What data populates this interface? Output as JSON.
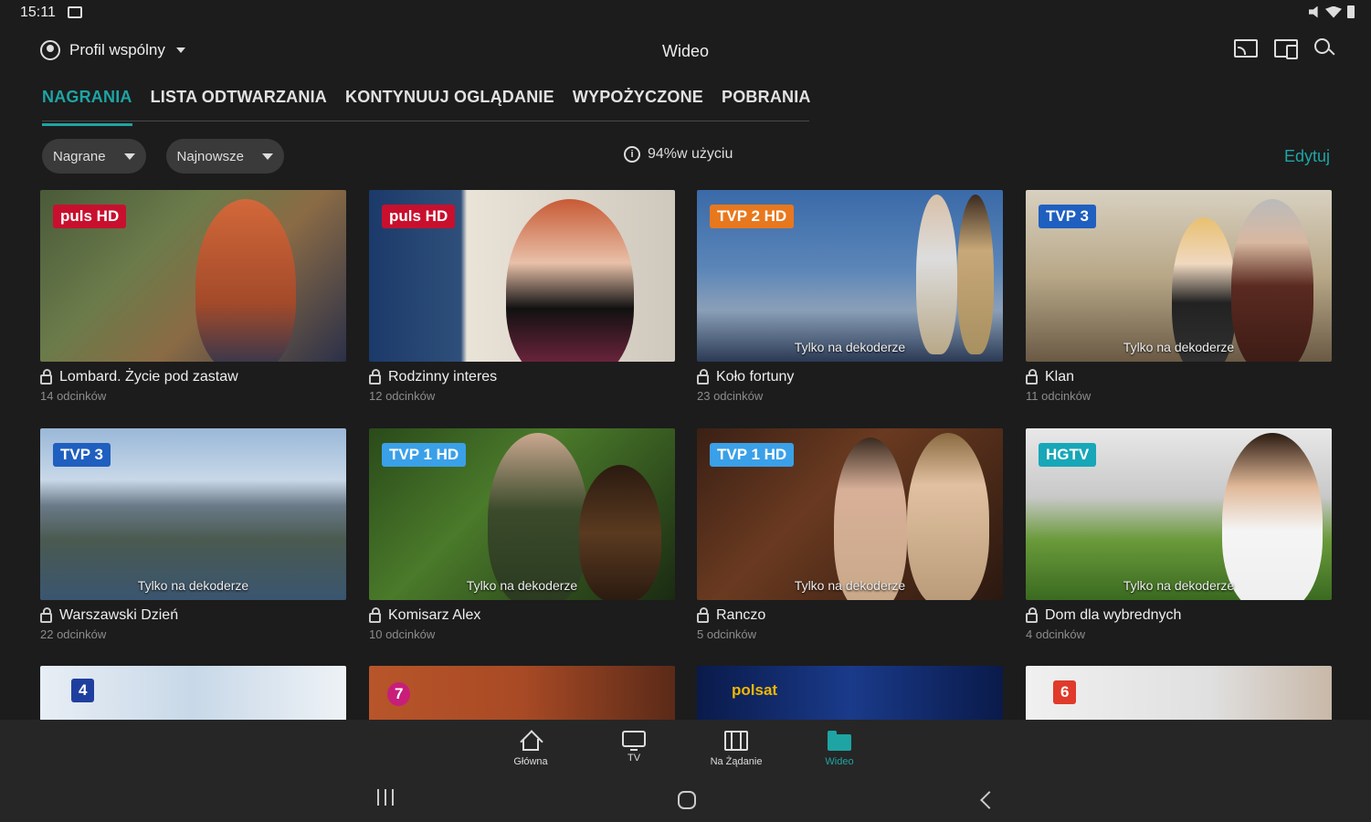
{
  "status": {
    "time": "15:11"
  },
  "header": {
    "profile_label": "Profil wspólny",
    "title": "Wideo"
  },
  "tabs": [
    {
      "label": "NAGRANIA",
      "active": true
    },
    {
      "label": "LISTA ODTWARZANIA",
      "active": false
    },
    {
      "label": "KONTYNUUJ OGLĄDANIE",
      "active": false
    },
    {
      "label": "WYPOŻYCZONE",
      "active": false
    },
    {
      "label": "POBRANIA",
      "active": false
    }
  ],
  "filters": {
    "type_selected": "Nagrane",
    "sort_selected": "Najnowsze"
  },
  "usage_text": "94%w użyciu",
  "edit_label": "Edytuj",
  "accent_color": "#1fa4a4",
  "recordings": [
    {
      "title": "Lombard. Życie pod zastaw",
      "episodes": "14 odcinków",
      "channel": "puls HD",
      "overlay": ""
    },
    {
      "title": "Rodzinny interes",
      "episodes": "12 odcinków",
      "channel": "puls HD",
      "overlay": ""
    },
    {
      "title": "Koło fortuny",
      "episodes": "23 odcinków",
      "channel": "TVP 2 HD",
      "overlay": "Tylko na dekoderze"
    },
    {
      "title": "Klan",
      "episodes": "11 odcinków",
      "channel": "TVP 3",
      "overlay": "Tylko na dekoderze"
    },
    {
      "title": "Warszawski Dzień",
      "episodes": "22 odcinków",
      "channel": "TVP 3",
      "overlay": "Tylko na dekoderze"
    },
    {
      "title": "Komisarz Alex",
      "episodes": "10 odcinków",
      "channel": "TVP 1 HD",
      "overlay": "Tylko na dekoderze"
    },
    {
      "title": "Ranczo",
      "episodes": "5 odcinków",
      "channel": "TVP 1 HD",
      "overlay": "Tylko na dekoderze"
    },
    {
      "title": "Dom dla wybrednych",
      "episodes": "4 odcinków",
      "channel": "HGTV",
      "overlay": "Tylko na dekoderze"
    }
  ],
  "partial_row_channels": [
    "4",
    "7",
    "polsat",
    "6"
  ],
  "bottom_nav": [
    {
      "label": "Główna",
      "icon": "home-icon",
      "active": false
    },
    {
      "label": "TV",
      "icon": "tv-icon",
      "active": false
    },
    {
      "label": "Na Żądanie",
      "icon": "film-icon",
      "active": false
    },
    {
      "label": "Wideo",
      "icon": "folder-icon",
      "active": true
    }
  ]
}
